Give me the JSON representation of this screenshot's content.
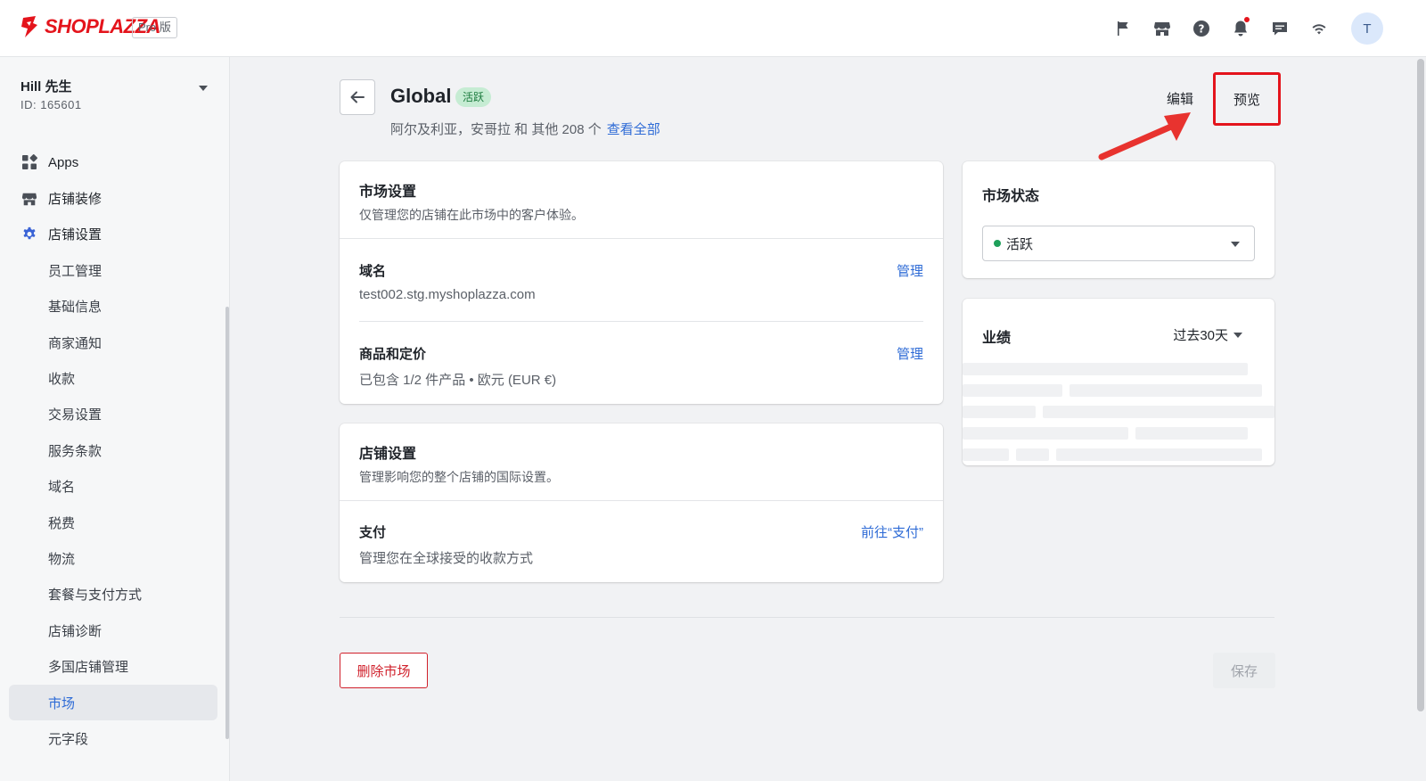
{
  "brand": {
    "logo_text": "SHOPLAZZA",
    "plan_badge": "Pro 版"
  },
  "topbar": {
    "icons": [
      "flag-icon",
      "store-icon",
      "help-icon",
      "bell-icon",
      "chat-icon",
      "wifi-icon"
    ],
    "avatar_initial": "T"
  },
  "account": {
    "name": "Hill 先生",
    "id": "ID: 165601"
  },
  "sidebar": {
    "items": [
      {
        "label": "Apps",
        "icon": "apps-icon"
      },
      {
        "label": "店铺装修",
        "icon": "store-icon"
      },
      {
        "label": "店铺设置",
        "icon": "gear-icon"
      },
      {
        "label": "员工管理"
      },
      {
        "label": "基础信息"
      },
      {
        "label": "商家通知"
      },
      {
        "label": "收款"
      },
      {
        "label": "交易设置"
      },
      {
        "label": "服务条款"
      },
      {
        "label": "域名"
      },
      {
        "label": "税费"
      },
      {
        "label": "物流"
      },
      {
        "label": "套餐与支付方式"
      },
      {
        "label": "店铺诊断"
      },
      {
        "label": "多国店铺管理"
      },
      {
        "label": "市场"
      },
      {
        "label": "元字段"
      }
    ],
    "active": "市场"
  },
  "header": {
    "title": "Global",
    "status": "活跃",
    "subtitle": "阿尔及利亚，安哥拉 和 其他 208 个",
    "view_all": "查看全部",
    "edit_label": "编辑",
    "preview_label": "预览"
  },
  "market_settings": {
    "title": "市场设置",
    "desc": "仅管理您的店铺在此市场中的客户体验。",
    "domain": {
      "title": "域名",
      "value": "test002.stg.myshoplazza.com",
      "link": "管理"
    },
    "products": {
      "title": "商品和定价",
      "value": "已包含 1/2 件产品 • 欧元 (EUR €)",
      "link": "管理"
    }
  },
  "store_settings": {
    "title": "店铺设置",
    "desc": "管理影响您的整个店铺的国际设置。",
    "payment": {
      "title": "支付",
      "value": "管理您在全球接受的收款方式",
      "link": "前往“支付”"
    }
  },
  "market_status": {
    "title": "市场状态",
    "selected": "活跃"
  },
  "performance": {
    "title": "业绩",
    "period": "过去30天"
  },
  "footer": {
    "delete_label": "删除市场",
    "save_label": "保存"
  },
  "colors": {
    "accent": "#2e6bd6",
    "danger": "#d0202b",
    "brand": "#e4141c",
    "success": "#1ea05a"
  }
}
